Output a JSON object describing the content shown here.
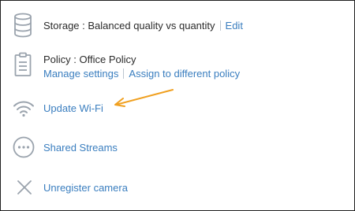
{
  "storage": {
    "label": "Storage : Balanced quality vs quantity",
    "edit_label": "Edit"
  },
  "policy": {
    "label": "Policy : Office Policy",
    "manage_label": "Manage settings",
    "assign_label": "Assign to different policy"
  },
  "wifi": {
    "update_label": "Update Wi-Fi"
  },
  "streams": {
    "label": "Shared Streams"
  },
  "unregister": {
    "label": "Unregister camera"
  },
  "colors": {
    "link": "#3a7ebf",
    "icon": "#9aa3ad",
    "annotation_arrow": "#f0a020"
  },
  "icons": [
    "database-icon",
    "clipboard-icon",
    "wifi-icon",
    "more-icon",
    "close-icon",
    "arrow-annotation"
  ]
}
